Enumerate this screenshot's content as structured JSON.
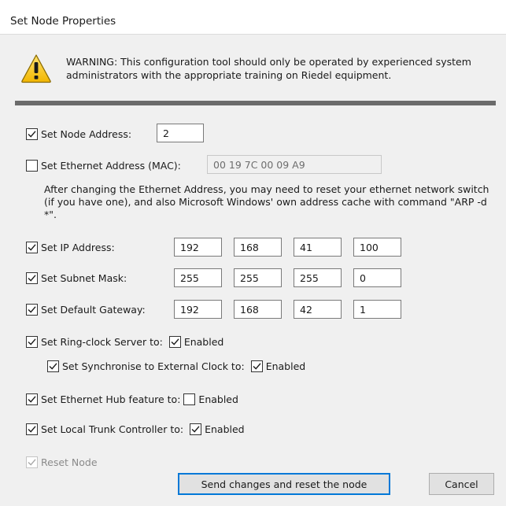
{
  "window": {
    "title": "Set Node Properties"
  },
  "warning": {
    "icon": "warning-icon",
    "text": "WARNING: This configuration tool should only be operated by experienced system administrators with the appropriate training on Riedel equipment."
  },
  "node_address": {
    "label": "Set Node Address:",
    "checked": true,
    "value": "2"
  },
  "mac": {
    "label": "Set Ethernet Address (MAC):",
    "checked": false,
    "value": "00 19 7C 00 09 A9"
  },
  "info_text": "After changing the Ethernet Address, you may need to reset your ethernet network switch (if you have one), and also Microsoft Windows' own address cache with command \"ARP -d *\".",
  "ip": {
    "label": "Set IP Address:",
    "checked": true,
    "octets": [
      "192",
      "168",
      "41",
      "100"
    ]
  },
  "subnet": {
    "label": "Set Subnet Mask:",
    "checked": true,
    "octets": [
      "255",
      "255",
      "255",
      "0"
    ]
  },
  "gateway": {
    "label": "Set Default Gateway:",
    "checked": true,
    "octets": [
      "192",
      "168",
      "42",
      "1"
    ]
  },
  "ring_clock": {
    "label": "Set Ring-clock Server to:",
    "checked": true,
    "enabled_label": "Enabled",
    "enabled": true
  },
  "sync_external": {
    "label": "Set Synchronise to External Clock to:",
    "checked": true,
    "enabled_label": "Enabled",
    "enabled": true
  },
  "hub": {
    "label": "Set Ethernet Hub feature to:",
    "checked": true,
    "enabled_label": "Enabled",
    "enabled": false
  },
  "trunk": {
    "label": "Set Local Trunk Controller to:",
    "checked": true,
    "enabled_label": "Enabled",
    "enabled": true
  },
  "reset_node": {
    "label": "Reset Node",
    "checked": true,
    "disabled": true
  },
  "buttons": {
    "send": "Send changes and reset the node",
    "cancel": "Cancel"
  },
  "colors": {
    "accent": "#0078d7",
    "separator": "#6b6b6b",
    "background": "#f0f0f0"
  }
}
